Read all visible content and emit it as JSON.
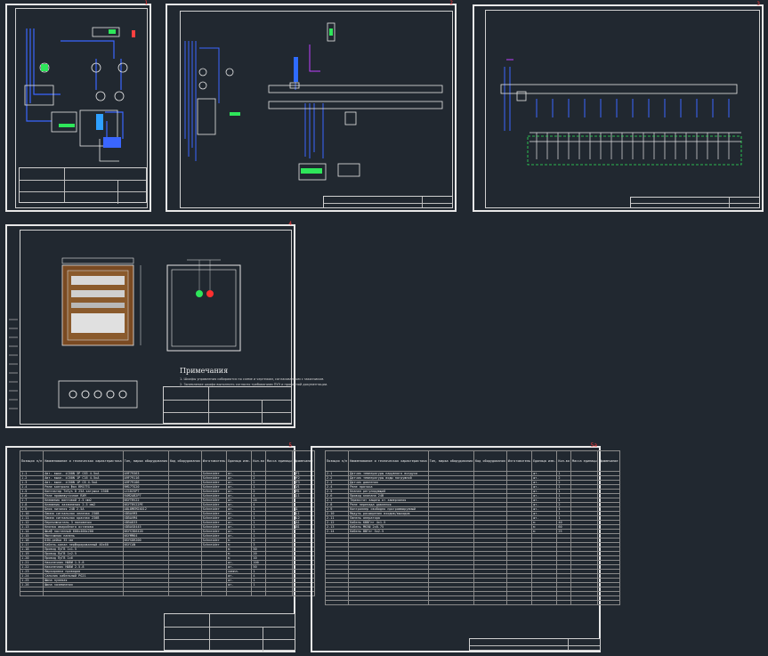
{
  "sheets": {
    "s1": {
      "number": "1"
    },
    "s2": {
      "number": "2"
    },
    "s3": {
      "number": "3"
    },
    "s4": {
      "number": "4"
    },
    "s5": {
      "number": "5"
    },
    "s6": {
      "number": "5a"
    }
  },
  "note": {
    "title": "Примечания",
    "lines": [
      "1. Шкафы управления собираются по схеме и чертежам, согласованным с заказчиком.",
      "2. Заземление шкафа выполнить согласно требованиям ПУЭ и проектной документации."
    ]
  },
  "spec_table_left": {
    "headers": [
      "Позиция п/п",
      "Наименование и техническая характеристика",
      "Тип, марка оборудования",
      "Код оборудования",
      "Изготовитель",
      "Единица изм.",
      "Кол-во",
      "Масса единицы",
      "Примечание"
    ],
    "rows": [
      [
        "1.1",
        "Авт. выкл. iC60N 3P C63 4.5кА",
        "A9F79363",
        "",
        "Schneider",
        "шт.",
        "1",
        "",
        "QF1"
      ],
      [
        "1.2",
        "Авт. выкл. iC60N 1P C16 4.5кА",
        "A9F79116",
        "",
        "Schneider",
        "шт.",
        "2",
        "",
        "QF2"
      ],
      [
        "1.3",
        "Авт. выкл. iC60N 1P C6 4.5кА",
        "A9F79106",
        "",
        "Schneider",
        "шт.",
        "2",
        "",
        "QF3"
      ],
      [
        "1.4",
        "Реле контроля фаз RM17TG",
        "RM17TG20",
        "",
        "Schneider",
        "шт.",
        "1",
        "",
        "KV1"
      ],
      [
        "1.5",
        "Контактор TeSys D 25А катушка 230В",
        "LC1D25P7",
        "",
        "Schneider",
        "шт.",
        "2",
        "",
        "KM1"
      ],
      [
        "1.6",
        "Реле промежуточное RXM",
        "RXM2AB2P7",
        "",
        "Schneider",
        "шт.",
        "4",
        "",
        "KL1"
      ],
      [
        "1.7",
        "Клеммник винтовой 2.5 мм2",
        "NSYTRV22",
        "",
        "Schneider",
        "шт.",
        "24",
        "",
        ""
      ],
      [
        "1.8",
        "Клеммник заземления 2.5 мм2",
        "NSYTRV22PE",
        "",
        "Schneider",
        "шт.",
        "4",
        "",
        ""
      ],
      [
        "1.9",
        "Блок питания 24В 2.5А",
        "ABL8MEM24012",
        "",
        "Schneider",
        "шт.",
        "1",
        "",
        "G1"
      ],
      [
        "1.10",
        "Лампа сигнальная зеленая 230В",
        "XB5AVM3",
        "",
        "Schneider",
        "шт.",
        "1",
        "",
        "HL1"
      ],
      [
        "1.11",
        "Лампа сигнальная красная 230В",
        "XB5AVM4",
        "",
        "Schneider",
        "шт.",
        "1",
        "",
        "HL2"
      ],
      [
        "1.12",
        "Переключатель 3 положения",
        "XB5AD33",
        "",
        "Schneider",
        "шт.",
        "1",
        "",
        "SA1"
      ],
      [
        "1.13",
        "Кнопка аварийного останова",
        "XB5AS8445",
        "",
        "Schneider",
        "шт.",
        "1",
        "",
        "SB1"
      ],
      [
        "1.14",
        "Шкаф настенный 600х400х200",
        "NSYS3D6420",
        "",
        "Schneider",
        "шт.",
        "1",
        "",
        ""
      ],
      [
        "1.15",
        "Монтажная панель",
        "NSYMM64",
        "",
        "Schneider",
        "шт.",
        "1",
        "",
        ""
      ],
      [
        "1.16",
        "DIN-рейка 35 мм",
        "NSYSDR200",
        "",
        "Schneider",
        "м",
        "2",
        "",
        ""
      ],
      [
        "1.17",
        "Кабель-канал перфорированный 40х60",
        "NSYCAN",
        "",
        "Schneider",
        "м",
        "3",
        "",
        ""
      ],
      [
        "1.18",
        "Провод ПуГВ 1х1.5",
        "",
        "",
        "",
        "м",
        "50",
        "",
        ""
      ],
      [
        "1.19",
        "Провод ПуГВ 1х2.5",
        "",
        "",
        "",
        "м",
        "20",
        "",
        ""
      ],
      [
        "1.20",
        "Провод ПуГВ 1х6",
        "",
        "",
        "",
        "м",
        "10",
        "",
        ""
      ],
      [
        "1.21",
        "Наконечник НШВИ 1.5-8",
        "",
        "",
        "",
        "шт.",
        "100",
        "",
        ""
      ],
      [
        "1.22",
        "Наконечник НШВИ 2.5-8",
        "",
        "",
        "",
        "шт.",
        "50",
        "",
        ""
      ],
      [
        "1.23",
        "Маркировка проводов",
        "",
        "",
        "",
        "компл.",
        "1",
        "",
        ""
      ],
      [
        "1.24",
        "Сальник кабельный PG21",
        "",
        "",
        "",
        "шт.",
        "4",
        "",
        ""
      ],
      [
        "1.25",
        "Шина нулевая",
        "",
        "",
        "",
        "шт.",
        "1",
        "",
        ""
      ],
      [
        "1.26",
        "Шина заземления",
        "",
        "",
        "",
        "шт.",
        "1",
        "",
        ""
      ]
    ]
  },
  "spec_table_right": {
    "headers": [
      "Позиция п/п",
      "Наименование и техническая характеристика",
      "Тип, марка оборудования",
      "Код оборудования",
      "Изготовитель",
      "Единица изм.",
      "Кол-во",
      "Масса единицы",
      "Примечание"
    ],
    "rows": [
      [
        "2.1",
        "Датчик температуры наружного воздуха",
        "",
        "",
        "",
        "шт.",
        "1",
        "",
        ""
      ],
      [
        "2.2",
        "Датчик температуры воды погружной",
        "",
        "",
        "",
        "шт.",
        "2",
        "",
        ""
      ],
      [
        "2.3",
        "Датчик давления",
        "",
        "",
        "",
        "шт.",
        "2",
        "",
        ""
      ],
      [
        "2.4",
        "Реле протока",
        "",
        "",
        "",
        "шт.",
        "1",
        "",
        ""
      ],
      [
        "2.5",
        "Клапан регулирующий",
        "",
        "",
        "",
        "шт.",
        "1",
        "",
        ""
      ],
      [
        "2.6",
        "Привод клапана 24В",
        "",
        "",
        "",
        "шт.",
        "1",
        "",
        ""
      ],
      [
        "2.7",
        "Термостат защиты от замерзания",
        "",
        "",
        "",
        "шт.",
        "1",
        "",
        ""
      ],
      [
        "2.8",
        "Реле перепада давления",
        "",
        "",
        "",
        "шт.",
        "2",
        "",
        ""
      ],
      [
        "2.9",
        "Контроллер свободно программируемый",
        "",
        "",
        "",
        "шт.",
        "1",
        "",
        ""
      ],
      [
        "2.10",
        "Модуль расширения входов/выходов",
        "",
        "",
        "",
        "шт.",
        "1",
        "",
        ""
      ],
      [
        "2.11",
        "Панель оператора",
        "",
        "",
        "",
        "шт.",
        "1",
        "",
        ""
      ],
      [
        "2.12",
        "Кабель КВВГнг 4х1.5",
        "",
        "",
        "",
        "м",
        "40",
        "",
        ""
      ],
      [
        "2.13",
        "Кабель МКЭШ 2х0.75",
        "",
        "",
        "",
        "м",
        "60",
        "",
        ""
      ],
      [
        "2.14",
        "Кабель ВВГнг 5х2.5",
        "",
        "",
        "",
        "м",
        "25",
        "",
        ""
      ]
    ]
  }
}
